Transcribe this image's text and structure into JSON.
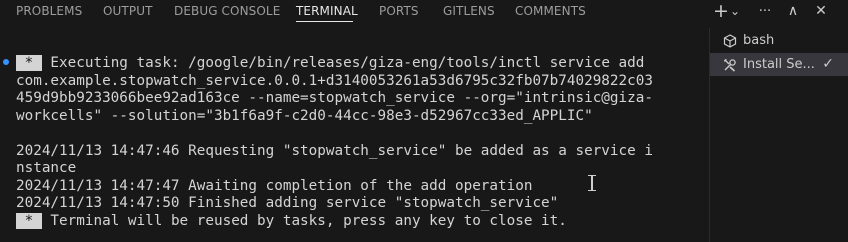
{
  "tabs": [
    {
      "label": "PROBLEMS"
    },
    {
      "label": "OUTPUT"
    },
    {
      "label": "DEBUG CONSOLE"
    },
    {
      "label": "TERMINAL"
    },
    {
      "label": "PORTS"
    },
    {
      "label": "GITLENS"
    },
    {
      "label": "COMMENTS"
    }
  ],
  "active_tab": "TERMINAL",
  "toolbar": {
    "new_terminal_glyph": "+",
    "dropdown_glyph": "⌄",
    "more_glyph": "···",
    "maximize_glyph": "∧",
    "close_glyph": "✕"
  },
  "terminal": {
    "task_marker": " * ",
    "task_line_1": " Executing task: /google/bin/releases/giza-eng/tools/inctl service add",
    "task_line_2": "com.example.stopwatch_service.0.0.1+d3140053261a53d6795c32fb07b74029822c03",
    "task_line_3": "459d9bb9233066bee92ad163ce --name=stopwatch_service --org=\"intrinsic@giza-",
    "task_line_4": "workcells\" --solution=\"3b1f6a9f-c2d0-44cc-98e3-d52967cc33ed_APPLIC\"",
    "log_line_1": "2024/11/13 14:47:46 Requesting \"stopwatch_service\" be added as a service i",
    "log_line_2": "nstance",
    "log_line_3": "2024/11/13 14:47:47 Awaiting completion of the add operation",
    "log_line_4": "2024/11/13 14:47:50 Finished adding service \"stopwatch_service\"",
    "reuse_marker": " * ",
    "reuse_line": " Terminal will be reused by tasks, press any key to close it."
  },
  "terminal_list": [
    {
      "label": "bash",
      "icon": "terminal-icon"
    },
    {
      "label": "Install Se...",
      "icon": "tools-icon",
      "status": "check-icon"
    }
  ],
  "colors": {
    "background": "#181818",
    "text": "#d4d4d4",
    "inactive_tab": "#9d9d9d",
    "selected_item": "#37373d",
    "run_indicator": "#3794ff"
  }
}
